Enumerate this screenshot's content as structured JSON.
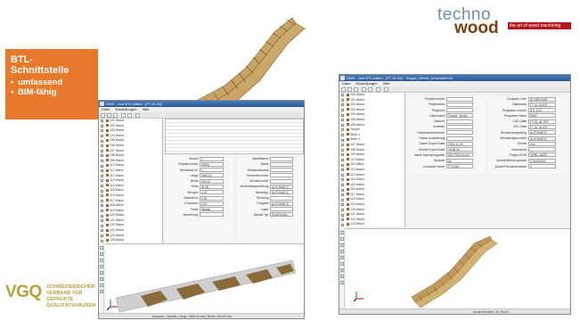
{
  "callout": {
    "title_line1": "BTL-",
    "title_line2": "Schnittstelle",
    "bullets": [
      "umfassend",
      "BIM-fähig"
    ],
    "bg_color": "#e8782a"
  },
  "logo_techno": {
    "techno": "techno",
    "wood": "wood",
    "tagline": "the art of wood machining",
    "accent_color": "#b8141b"
  },
  "logo_vgq": {
    "mark": "VGQ",
    "lines": [
      "SCHWEIZERISCHER",
      "VERBAND FÜR",
      "GEPRÜFTE",
      "QUALITÄTSHÄUSER"
    ],
    "color": "#b7a23a"
  },
  "left_window": {
    "title": "DWS - vest BTL edited - [FT-01-04]",
    "menu": [
      "Datei",
      "Einstellungen",
      "Hilfe"
    ],
    "tree_items": [
      "101 Wand",
      "102 Wand",
      "103 Wand",
      "104 Wand",
      "105 Wand",
      "106 Wand",
      "107 Wand",
      "108 Wand",
      "109 Wand",
      "110 Wand",
      "111 Wand",
      "112 Wand",
      "113 Wand",
      "114 Wand",
      "115 Wand",
      "116 Wand",
      "117 Wand",
      "118 Wand",
      "119 Wand",
      "120 Wand",
      "121 Wand",
      "122 Wand",
      "123 Wand",
      "124 Wand",
      "125 Wand",
      "126 Wand",
      "127 Wand",
      "128 Wand",
      "129 Wand",
      "130 Wand",
      "131 Wand",
      "132 Wand"
    ],
    "props_left": [
      {
        "label": "Anzahl",
        "value": "1"
      },
      {
        "label": "Projektnummer",
        "value": "00694"
      },
      {
        "label": "Werkstück-Nr.",
        "value": "1"
      },
      {
        "label": "Länge",
        "value": "3600.00"
      },
      {
        "label": "Breite",
        "value": "300.00"
      },
      {
        "label": "Höhe",
        "value": "50.00"
      },
      {
        "label": "Mengen",
        "value": "0.00"
      },
      {
        "label": "Startwinkel",
        "value": "0.00"
      },
      {
        "label": "Endwinkel",
        "value": "0.00"
      },
      {
        "label": "Farbe",
        "value": "Wange"
      },
      {
        "label": "Bemerkung",
        "value": ""
      }
    ],
    "props_right": [
      {
        "label": "Identifikation",
        "value": ""
      },
      {
        "label": "Name",
        "value": ""
      },
      {
        "label": "Werkstückname",
        "value": ""
      },
      {
        "label": "Elementnummer",
        "value": ""
      },
      {
        "label": "Modulnummer",
        "value": ""
      },
      {
        "label": "Verarbeitungsrichtung",
        "value": "AUTOMATIC"
      },
      {
        "label": "Bauteiltyp",
        "value": "AUTOMATIC"
      },
      {
        "label": "Rundung",
        "value": ""
      },
      {
        "label": "Freigabe",
        "value": "AUTOMATIC"
      },
      {
        "label": "Layer",
        "value": ""
      },
      {
        "label": "Bauteil-Typ",
        "value": "EINZELBAU"
      }
    ],
    "status": "Auswahl: 1 Bauteil  |  Länge: 3600.00 mm  |  Breite: 300.00 mm"
  },
  "right_window": {
    "title": "DWS - vest BTL edited - [FT-01-04] - Treppe_Viertel_Gewendelt.btl",
    "menu": [
      "Datei",
      "Einstellungen",
      "Hilfe"
    ],
    "tree_items": [
      "100 Wand",
      "101 Wand",
      "102 Wand",
      "103 Wand",
      "104 Wand",
      "105 Wand",
      "106 Wand",
      "Treppe",
      "Stufe 1",
      "Stufe 2",
      "107 Wand",
      "108 Wand",
      "109 Wand",
      "110 Wand",
      "111 Wand",
      "112 Wand",
      "113 Wand",
      "114 Wand",
      "115 Wand",
      "116 Wand",
      "117 Wand",
      "118 Wand",
      "119 Wand",
      "120 Wand",
      "121 Wand",
      "122 Wand",
      "123 Wand",
      "124 Wand",
      "125 Wand",
      "126 Wand",
      "127 Wand",
      "128 Wand",
      "129 Wand",
      "130 Wand",
      "131 Wand"
    ],
    "props_left": [
      {
        "label": "Projektnummer",
        "value": ""
      },
      {
        "label": "Projektname",
        "value": ""
      },
      {
        "label": "Projektteil",
        "value": ""
      },
      {
        "label": "Listenname",
        "value": "Treppe_Viertel"
      },
      {
        "label": "Bauherr",
        "value": ""
      },
      {
        "label": "Architekt",
        "value": ""
      },
      {
        "label": "Holzbauunternehmer",
        "value": ""
      },
      {
        "label": "Datum Auslieferung",
        "value": ""
      },
      {
        "label": "Datum Export Datei",
        "value": "2015-11-30"
      },
      {
        "label": "Uhrzeit Export Datei",
        "value": "16:38:26"
      },
      {
        "label": "Name Exportprogramm",
        "value": "DIETRICH'S AG"
      },
      {
        "label": "Sprache",
        "value": "de"
      },
      {
        "label": "Computer-Name",
        "value": "PT-0040"
      }
    ],
    "props_right": [
      {
        "label": "Computer-User",
        "value": "SCHREINER"
      },
      {
        "label": "Dateiname",
        "value": "FT-01-04.BTL"
      },
      {
        "label": "Programm-Version",
        "value": "BTL 10.0"
      },
      {
        "label": "Programm-Name",
        "value": "DWS"
      },
      {
        "label": "CAD-Datei",
        "value": "FT-01-04.TRP"
      },
      {
        "label": "BTL-Datei",
        "value": "FT-01-04.BTL"
      },
      {
        "label": "Rechteckumgebung",
        "value": "AUTOMATIC"
      },
      {
        "label": "Werkstückgeometrie",
        "value": "AUTOMATIC"
      },
      {
        "label": "Einheit",
        "value": "mm"
      },
      {
        "label": "Kommentar",
        "value": ""
      },
      {
        "label": "Projekt-GUID",
        "value": "{3FB0-4A2E}"
      },
      {
        "label": "Anzahl Bahnen gesamt",
        "value": "STANDARD"
      },
      {
        "label": "Anzahl Fensterelemente",
        "value": "0"
      }
    ],
    "status": "Anzahl Bauteile: 36  |  Bereit"
  }
}
